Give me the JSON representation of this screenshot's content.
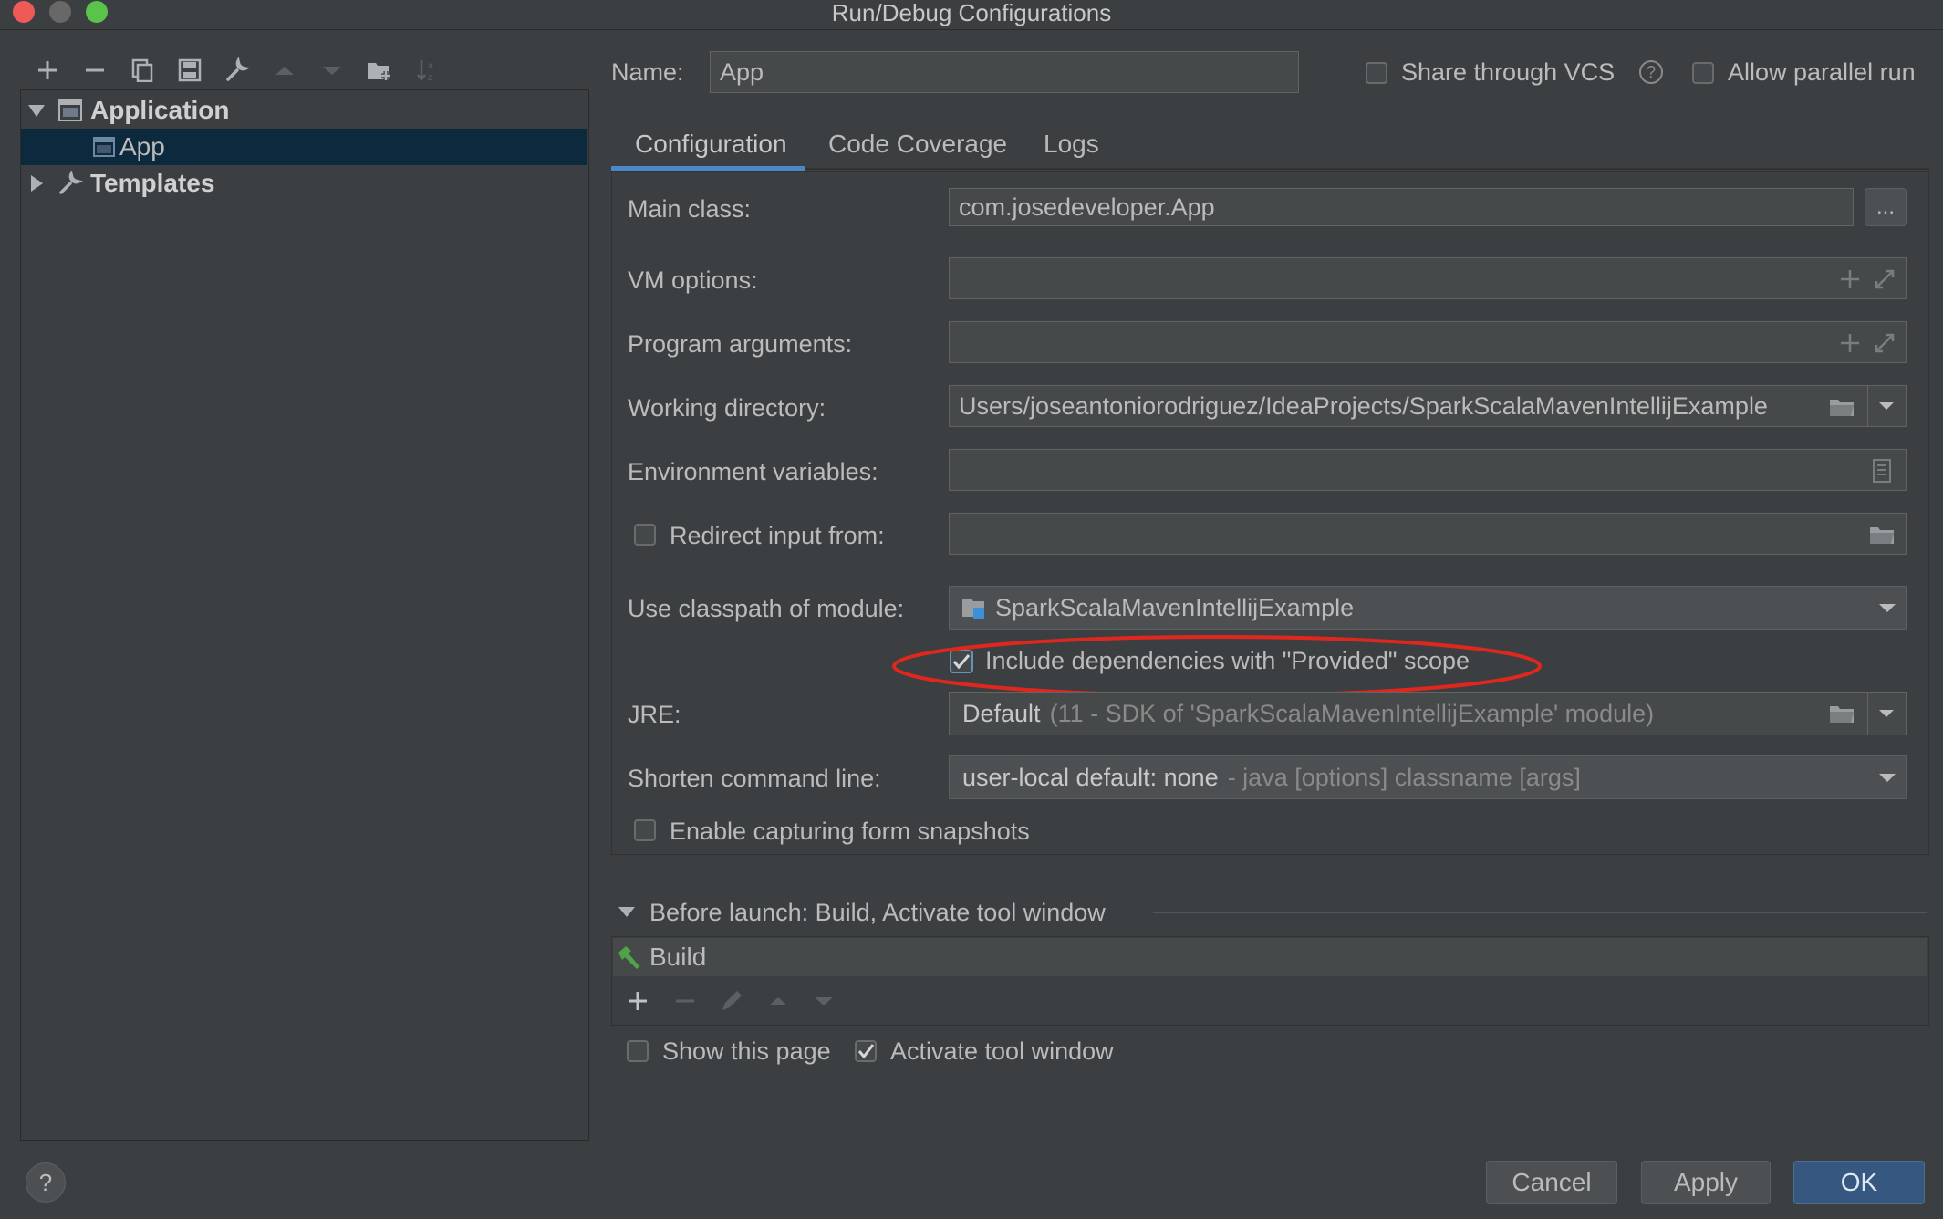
{
  "window": {
    "title": "Run/Debug Configurations"
  },
  "left_toolbar": {
    "icons": [
      "plus-icon",
      "minus-icon",
      "copy-icon",
      "save-icon",
      "wrench-icon",
      "arrow-up-icon",
      "arrow-down-icon",
      "new-folder-icon",
      "sort-icon"
    ]
  },
  "tree": {
    "application_label": "Application",
    "app_label": "App",
    "templates_label": "Templates"
  },
  "header": {
    "name_label": "Name:",
    "name_value": "App",
    "share_vcs_label": "Share through VCS",
    "help_symbol": "?",
    "allow_parallel_label": "Allow parallel run"
  },
  "tabs": [
    {
      "label": "Configuration",
      "active": true
    },
    {
      "label": "Code Coverage",
      "active": false
    },
    {
      "label": "Logs",
      "active": false
    }
  ],
  "config": {
    "main_class_label": "Main class:",
    "main_class_value": "com.josedeveloper.App",
    "browse_label": "...",
    "vm_options_label": "VM options:",
    "vm_options_value": "",
    "program_args_label": "Program arguments:",
    "program_args_value": "",
    "working_dir_label": "Working directory:",
    "working_dir_value": "Users/joseantoniorodriguez/IdeaProjects/SparkScalaMavenIntellijExample",
    "env_vars_label": "Environment variables:",
    "env_vars_value": "",
    "redirect_input_label": "Redirect input from:",
    "redirect_input_value": "",
    "classpath_label": "Use classpath of module:",
    "classpath_value": "SparkScalaMavenIntellijExample",
    "include_deps_label": "Include dependencies with \"Provided\" scope",
    "include_deps_checked": true,
    "jre_label": "JRE:",
    "jre_value": "Default",
    "jre_detail": "(11 - SDK of 'SparkScalaMavenIntellijExample' module)",
    "shorten_label": "Shorten command line:",
    "shorten_value": "user-local default: none",
    "shorten_detail": "- java [options] classname [args]",
    "enable_snapshots_label": "Enable capturing form snapshots",
    "enable_snapshots_checked": false
  },
  "before_launch": {
    "header": "Before launch: Build, Activate tool window",
    "items": [
      "Build"
    ],
    "show_page_label": "Show this page",
    "show_page_checked": false,
    "activate_window_label": "Activate tool window",
    "activate_window_checked": true
  },
  "footer": {
    "help_label": "?",
    "cancel_label": "Cancel",
    "apply_label": "Apply",
    "ok_label": "OK"
  },
  "colors": {
    "background": "#3c3f41",
    "accent": "#4a88c7",
    "selection": "#0d293e",
    "highlight_ellipse": "#e0271d",
    "primary_button": "#365880"
  }
}
